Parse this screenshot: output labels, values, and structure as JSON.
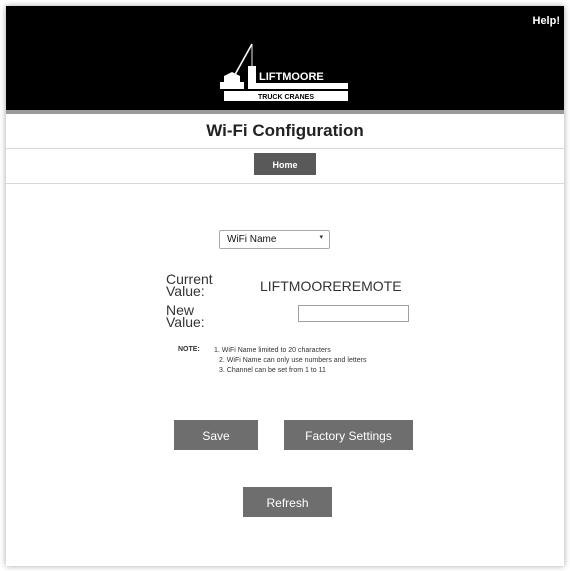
{
  "header": {
    "help_label": "Help!",
    "logo": {
      "brand_text": "LIFTMOORE",
      "sub_text": "TRUCK CRANES"
    }
  },
  "title": "Wi-Fi Configuration",
  "nav": {
    "home_label": "Home"
  },
  "setting_select": {
    "selected": "WiFi Name"
  },
  "current": {
    "label_line1": "Current",
    "label_line2": "Value:",
    "value": "LIFTMOOREREMOTE"
  },
  "new_value": {
    "label_line1": "New",
    "label_line2": "Value:",
    "input_value": ""
  },
  "note": {
    "label": "NOTE:",
    "lines": [
      "1. WiFi Name limited to 20 characters",
      "2. WiFi Name can only use numbers and letters",
      "3. Channel can be set from 1 to 11"
    ]
  },
  "buttons": {
    "save": "Save",
    "factory": "Factory Settings",
    "refresh": "Refresh"
  },
  "colors": {
    "header_bg": "#000000",
    "button_bg": "#6e6e6e",
    "home_button_bg": "#595959"
  }
}
